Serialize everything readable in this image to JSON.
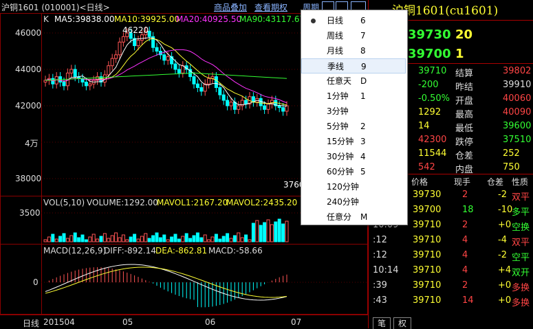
{
  "header": {
    "chart_title": "沪铜1601 (010001)<日线>",
    "links": [
      "商品叠加",
      "查看期权",
      "周期"
    ],
    "instrument_title": "沪铜1601(cu1601)"
  },
  "kline_panel": {
    "label": "K",
    "ma5": "MA5:39838.00",
    "ma10": "MA10:39925.00",
    "ma20": "MA20:40925.50",
    "ma90": "MA90:43117.67",
    "high_mark": "46220",
    "low_mark": "3760",
    "y_ticks": [
      "46000",
      "44000",
      "42000",
      "4万",
      "38000"
    ]
  },
  "volume_panel": {
    "label": "VOL(5,10)",
    "volume": "VOLUME:1292.00",
    "mavol1": "MAVOL1:2167.20",
    "mavol2": "MAVOL2:2435.20",
    "y_tick": "3500"
  },
  "macd_panel": {
    "label": "MACD(12,26,9)",
    "diff": "DIFF:-892.14",
    "dea": "DEA:-862.81",
    "macd": "MACD:-58.66",
    "y_tick": "0"
  },
  "x_axis": {
    "period_label": "日线",
    "ticks": [
      "201504",
      "05",
      "06",
      "07"
    ]
  },
  "period_menu": {
    "items": [
      {
        "label": "日线",
        "key": "6",
        "selected": true
      },
      {
        "label": "周线",
        "key": "7"
      },
      {
        "label": "月线",
        "key": "8"
      },
      {
        "label": "季线",
        "key": "9",
        "highlighted": true
      },
      {
        "label": "任意天",
        "key": "D"
      },
      {
        "label": "1分钟",
        "key": "1"
      },
      {
        "label": "3分钟",
        "key": ""
      },
      {
        "label": "5分钟",
        "key": "2"
      },
      {
        "label": "15分钟",
        "key": "3"
      },
      {
        "label": "30分钟",
        "key": "4"
      },
      {
        "label": "60分钟",
        "key": "5"
      },
      {
        "label": "120分钟",
        "key": ""
      },
      {
        "label": "240分钟",
        "key": ""
      },
      {
        "label": "任意分",
        "key": "M"
      }
    ]
  },
  "quote": {
    "ask_price": "39730",
    "ask_vol": "20",
    "bid_price": "39700",
    "bid_vol": "1",
    "rows": [
      {
        "v1": "39710",
        "l2": "结算",
        "v2": "39802"
      },
      {
        "v1": "-200",
        "l2": "昨结",
        "v2": "39910"
      },
      {
        "v1": "-0.50%",
        "l2": "开盘",
        "v2": "40060"
      },
      {
        "v1": "1292",
        "l2": "最高",
        "v2": "40090"
      },
      {
        "v1": "14",
        "l2": "最低",
        "v2": "39600"
      },
      {
        "v1": "42300",
        "l2": "跌停",
        "v2": "37510"
      },
      {
        "v1": "11544",
        "l2": "仓差",
        "v2": "252"
      },
      {
        "v1": "542",
        "l2": "内盘",
        "v2": "750"
      }
    ]
  },
  "ticks": {
    "headers": [
      "价格",
      "现手",
      "仓差",
      "性质"
    ],
    "rows": [
      {
        "time": "",
        "price": "39730",
        "vol": "2",
        "oi": "-2",
        "nature": "双平"
      },
      {
        "time": "",
        "price": "39700",
        "vol": "18",
        "oi": "-10",
        "nature": "多平"
      },
      {
        "time": "10:09",
        "price": "39710",
        "vol": "2",
        "oi": "+0",
        "nature": "空换"
      },
      {
        "time": ":12",
        "price": "39710",
        "vol": "4",
        "oi": "-4",
        "nature": "双平"
      },
      {
        "time": ":12",
        "price": "39710",
        "vol": "4",
        "oi": "-2",
        "nature": "空平"
      },
      {
        "time": "10:14",
        "price": "39710",
        "vol": "4",
        "oi": "+4",
        "nature": "双开"
      },
      {
        "time": ":39",
        "price": "39710",
        "vol": "2",
        "oi": "+0",
        "nature": "多换"
      },
      {
        "time": ":43",
        "price": "39710",
        "vol": "14",
        "oi": "+0",
        "nature": "多换"
      }
    ]
  },
  "bottom_tabs": [
    "笔",
    "权"
  ]
}
